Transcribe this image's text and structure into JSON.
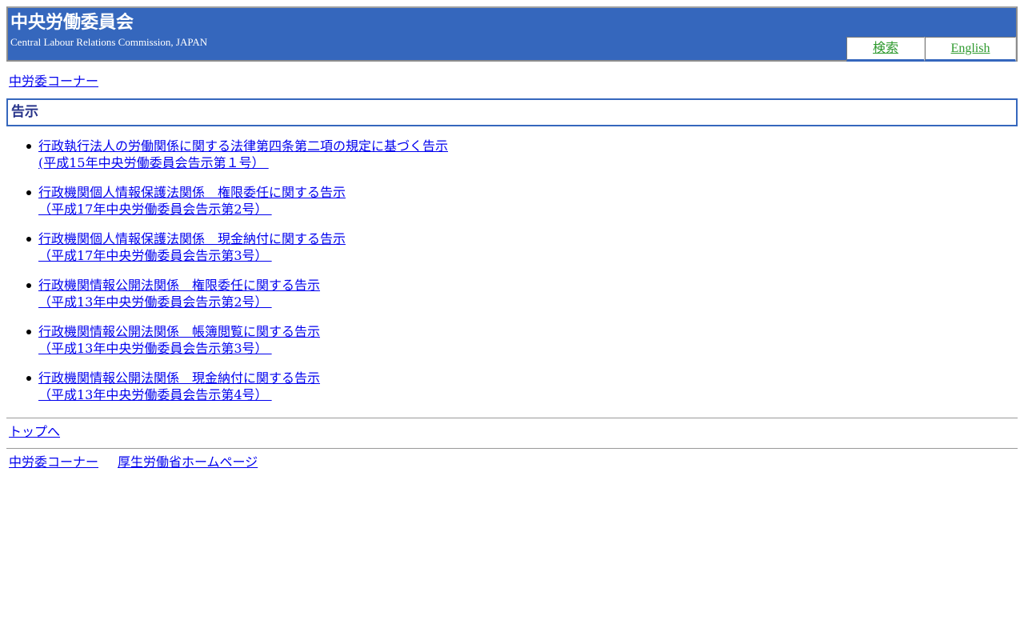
{
  "header": {
    "title": "中央労働委員会",
    "subtitle": "Central Labour Relations Commission, JAPAN",
    "nav": {
      "search_label": "検索",
      "english_label": "English"
    },
    "colors": {
      "banner": "#3567bd",
      "nav_link": "#2f9a2f"
    }
  },
  "breadcrumb": {
    "label": "中労委コーナー"
  },
  "section": {
    "heading": "告示"
  },
  "notices": [
    {
      "title": "行政執行法人の労働関係に関する法律第四条第二項の規定に基づく告示",
      "ref": "(平成15年中央労働委員会告示第１号） "
    },
    {
      "title": "行政機関個人情報保護法関係　権限委任に関する告示",
      "ref": "（平成17年中央労働委員会告示第2号） "
    },
    {
      "title": "行政機関個人情報保護法関係　現金納付に関する告示",
      "ref": "（平成17年中央労働委員会告示第3号） "
    },
    {
      "title": "行政機関情報公開法関係　権限委任に関する告示",
      "ref": "（平成13年中央労働委員会告示第2号） "
    },
    {
      "title": "行政機関情報公開法関係　帳簿閲覧に関する告示",
      "ref": "（平成13年中央労働委員会告示第3号） "
    },
    {
      "title": "行政機関情報公開法関係　現金納付に関する告示",
      "ref": "（平成13年中央労働委員会告示第4号） "
    }
  ],
  "to_top": {
    "label": "トップへ"
  },
  "footer": {
    "corner_label": "中労委コーナー",
    "mhlw_label": "厚生労働省ホームページ"
  }
}
